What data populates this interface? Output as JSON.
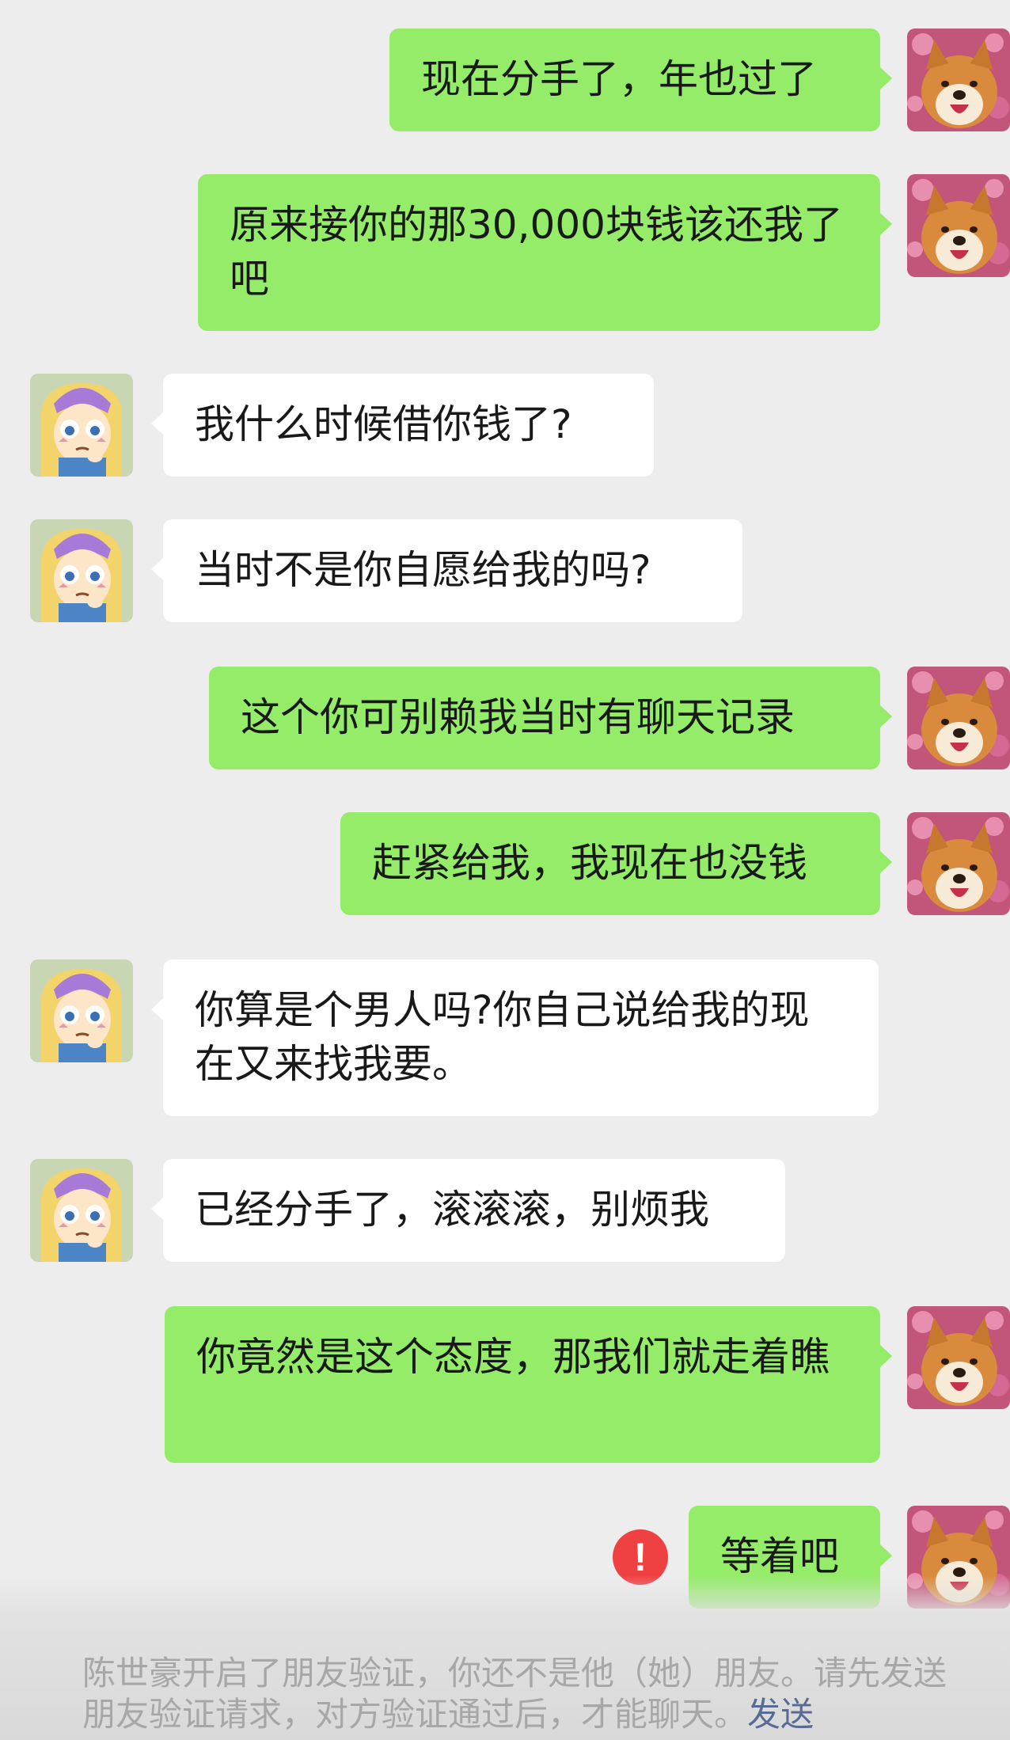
{
  "messages": [
    {
      "side": "me",
      "text": "现在分手了，年也过了"
    },
    {
      "side": "me",
      "text": "原来接你的那30,000块钱该还我了吧"
    },
    {
      "side": "peer",
      "text": "我什么时候借你钱了?"
    },
    {
      "side": "peer",
      "text": "当时不是你自愿给我的吗?"
    },
    {
      "side": "me",
      "text": "这个你可别赖我当时有聊天记录"
    },
    {
      "side": "me",
      "text": "赶紧给我，我现在也没钱"
    },
    {
      "side": "peer",
      "text": "你算是个男人吗?你自己说给我的现在又来找我要。"
    },
    {
      "side": "peer",
      "text": "已经分手了，滚滚滚，别烦我"
    },
    {
      "side": "me",
      "text": "你竟然是这个态度，那我们就走着瞧"
    },
    {
      "side": "me",
      "text": "等着吧",
      "failed": true
    }
  ],
  "error_icon": {
    "glyph": "!",
    "color": "#f04142"
  },
  "system_notice": {
    "text": "陈世豪开启了朋友验证，你还不是他（她）朋友。请先发送朋友验证请求，对方验证通过后，才能聊天。",
    "link": "发送"
  },
  "colors": {
    "background": "#ededed",
    "my_bubble": "#95ec69",
    "peer_bubble": "#ffffff",
    "link": "#576b95"
  },
  "avatars": {
    "me": "shiba-dog-avatar",
    "peer": "cartoon-girl-avatar"
  }
}
